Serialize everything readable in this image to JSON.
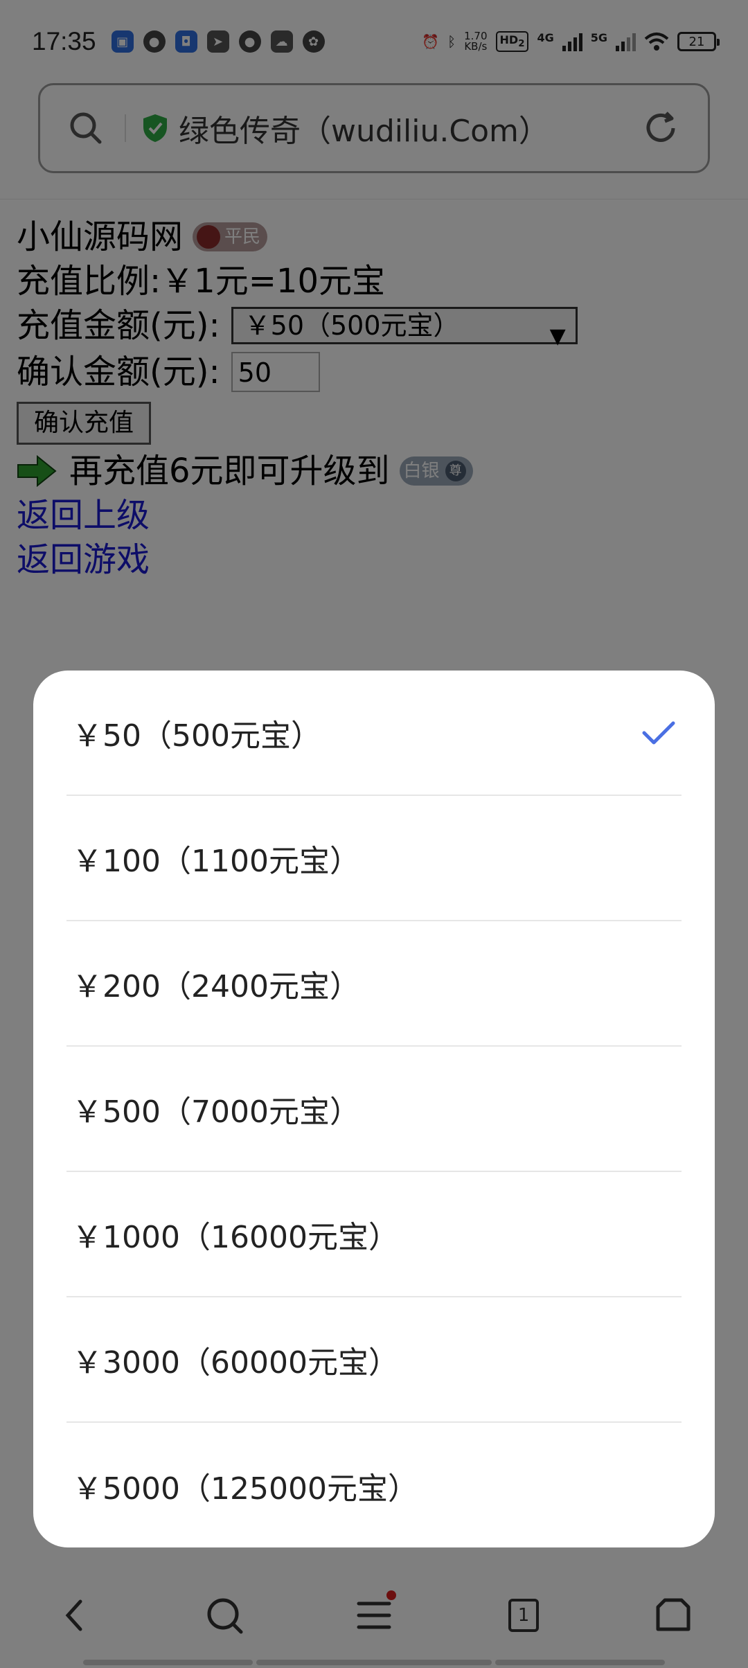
{
  "status_bar": {
    "time": "17:35",
    "speed_value": "1.70",
    "speed_unit": "KB/s",
    "hd_label": "HD",
    "hd_sub": "2",
    "net1": "4G",
    "net2": "5G",
    "battery": "21"
  },
  "address_bar": {
    "title": "绿色传奇（wudiliu.Com）"
  },
  "page": {
    "site_name": "小仙源码网",
    "rank_badge": "平民",
    "ratio_text": "充值比例:￥1元=10元宝",
    "amount_label": "充值金额(元):",
    "amount_selected": "￥50（500元宝）",
    "confirm_label": "确认金额(元):",
    "confirm_value": "50",
    "confirm_button": "确认充值",
    "upgrade_text": "再充值6元即可升级到",
    "upgrade_badge": "白银",
    "upgrade_badge_icon": "尊",
    "link_back": "返回上级",
    "link_game": "返回游戏"
  },
  "bottom_nav": {
    "tab_count": "1",
    "icons": [
      "back-icon",
      "search-icon",
      "menu-icon",
      "tabs-icon",
      "home-icon"
    ]
  },
  "picker": {
    "selected_index": 0,
    "accent_color": "#4a6fe3",
    "options": [
      "￥50（500元宝）",
      "￥100（1100元宝）",
      "￥200（2400元宝）",
      "￥500（7000元宝）",
      "￥1000（16000元宝）",
      "￥3000（60000元宝）",
      "￥5000（125000元宝）"
    ]
  }
}
